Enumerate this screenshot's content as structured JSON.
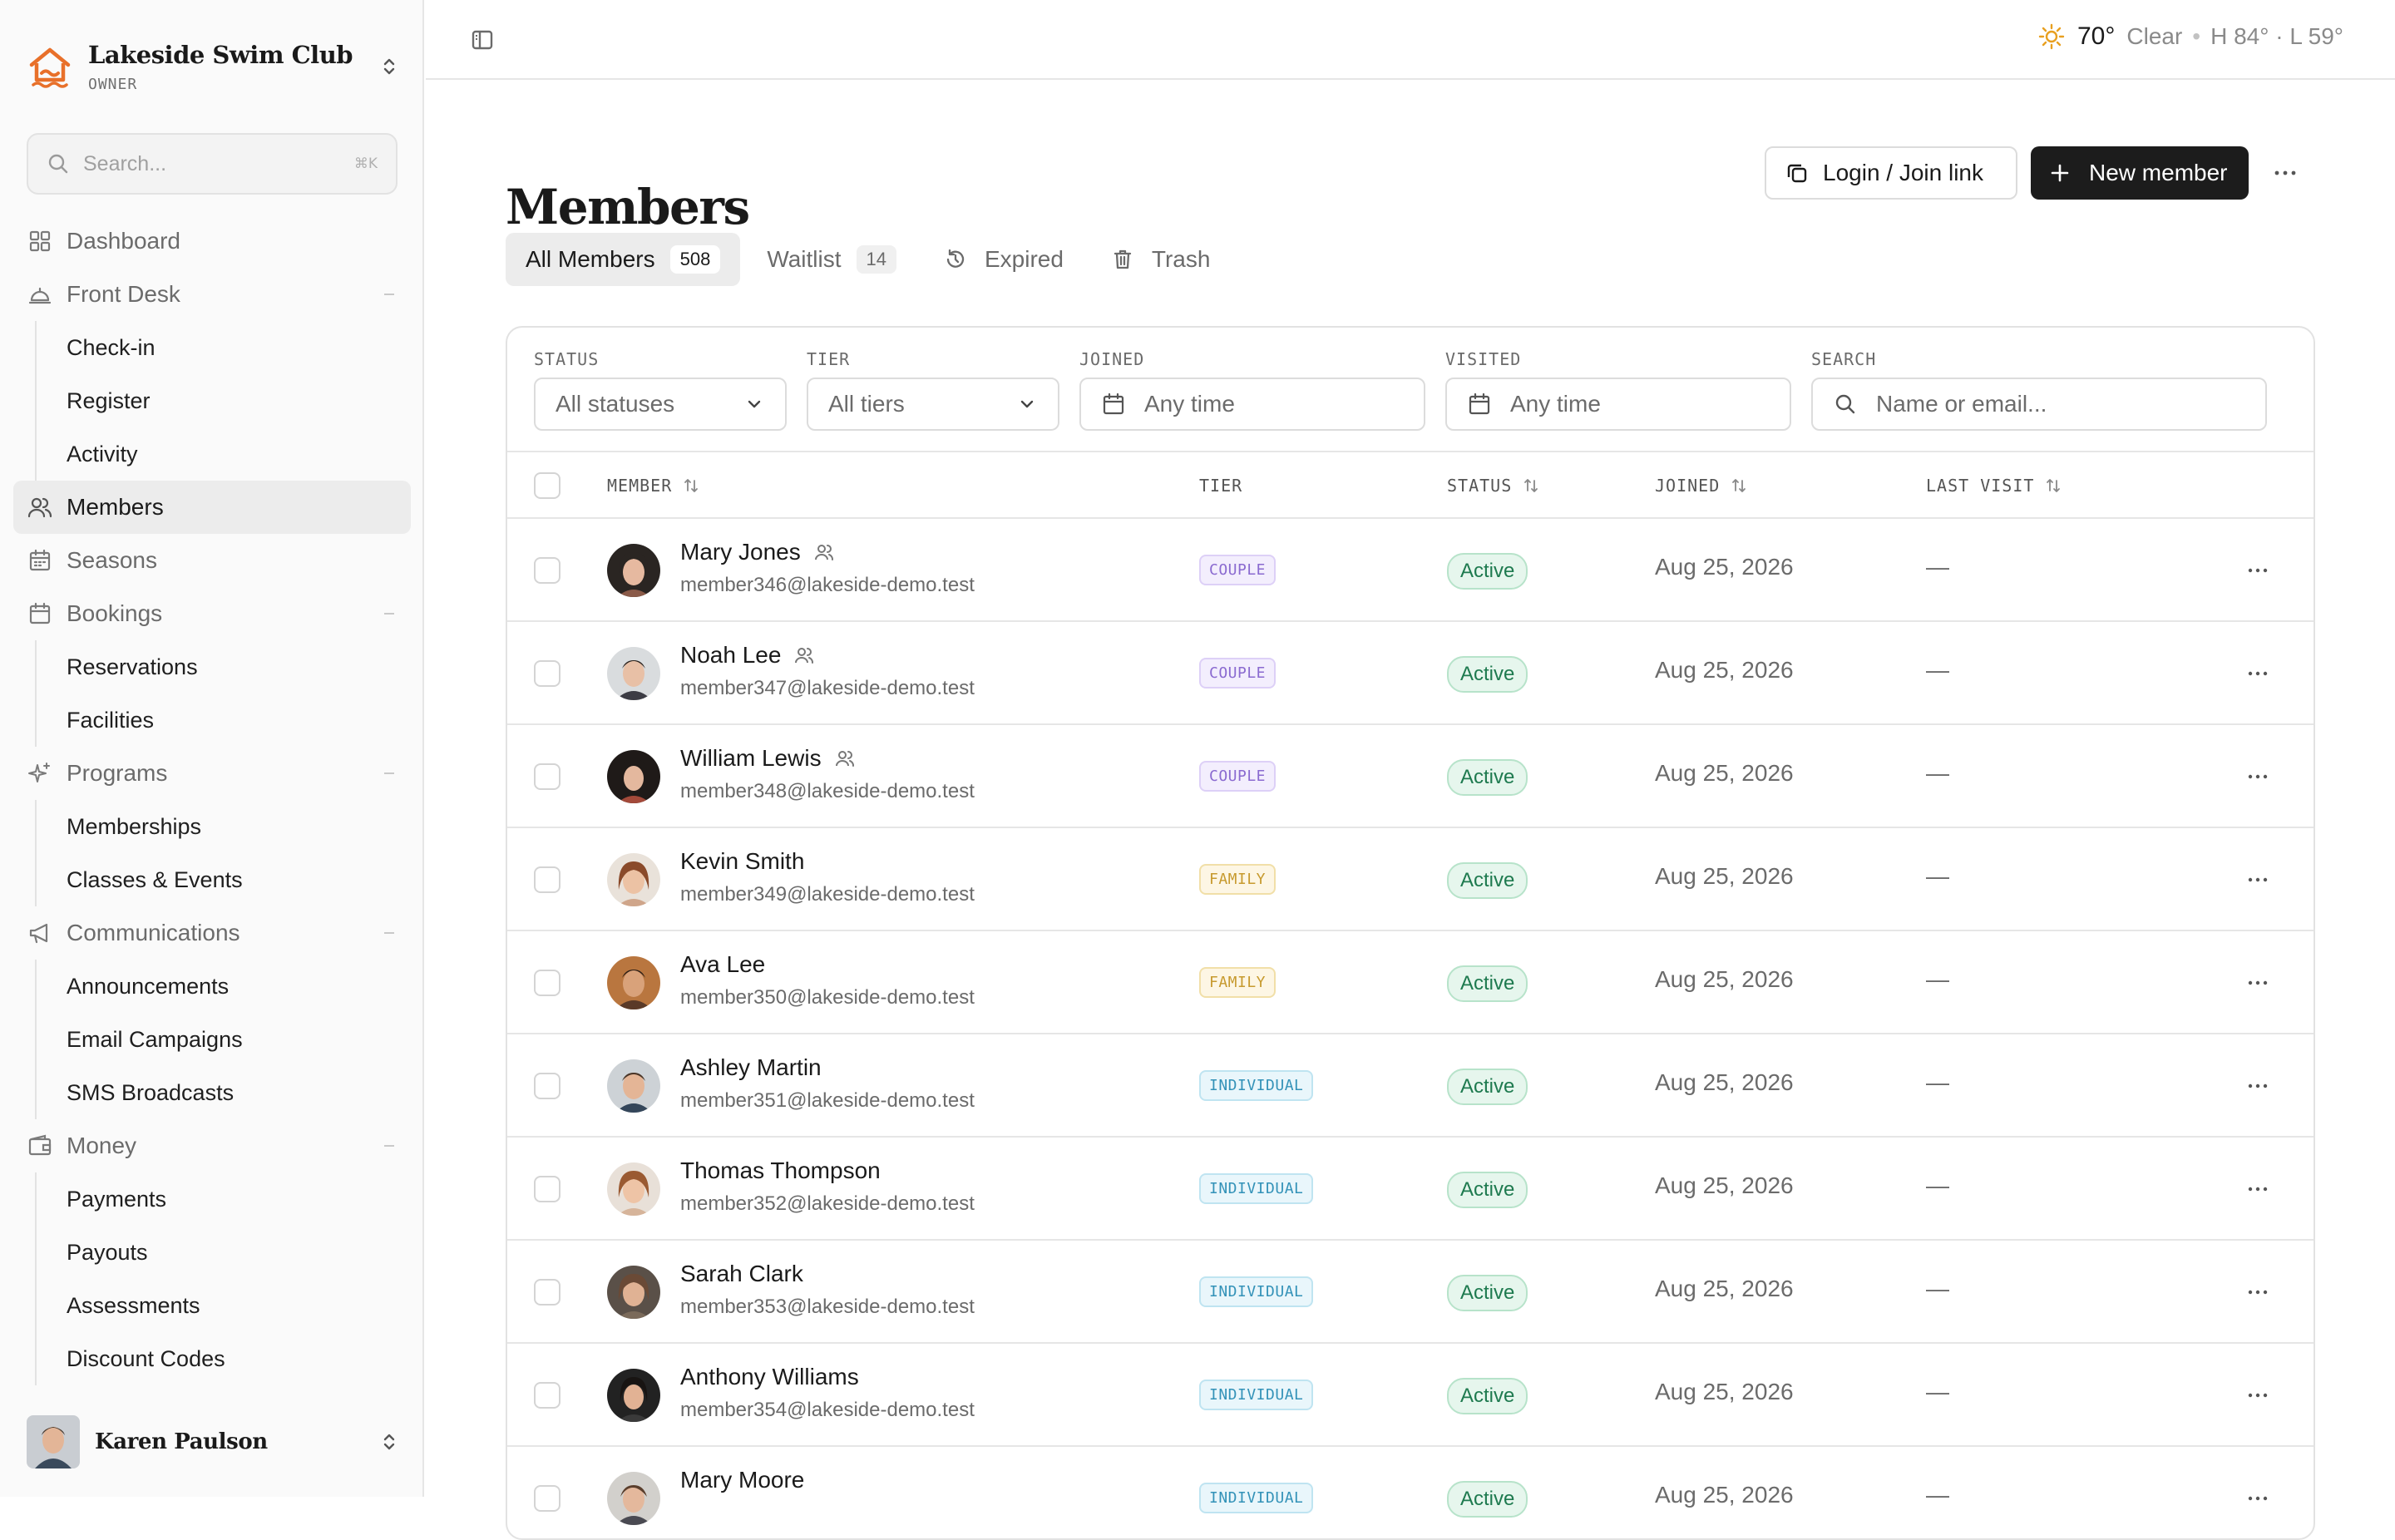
{
  "sidebar": {
    "club_name": "Lakeside Swim Club",
    "club_role": "OWNER",
    "search": {
      "placeholder": "Search...",
      "shortcut": "⌘K"
    },
    "nav": {
      "dashboard": "Dashboard",
      "front_desk": "Front Desk",
      "check_in": "Check-in",
      "register": "Register",
      "activity": "Activity",
      "members": "Members",
      "seasons": "Seasons",
      "bookings": "Bookings",
      "reservations": "Reservations",
      "facilities": "Facilities",
      "programs": "Programs",
      "memberships": "Memberships",
      "classes_events": "Classes & Events",
      "communications": "Communications",
      "announcements": "Announcements",
      "email_campaigns": "Email Campaigns",
      "sms_broadcasts": "SMS Broadcasts",
      "money": "Money",
      "payments": "Payments",
      "payouts": "Payouts",
      "assessments": "Assessments",
      "discount_codes": "Discount Codes"
    },
    "user": {
      "name": "Karen Paulson"
    }
  },
  "weather": {
    "temp": "70°",
    "condition": "Clear",
    "sep": "•",
    "high_low": "H 84° · L 59°"
  },
  "page": {
    "title": "Members",
    "login_link_label": "Login / Join link",
    "new_member_label": "New member"
  },
  "tabs": {
    "all_members": {
      "label": "All Members",
      "count": "508"
    },
    "waitlist": {
      "label": "Waitlist",
      "count": "14"
    },
    "expired": {
      "label": "Expired"
    },
    "trash": {
      "label": "Trash"
    }
  },
  "filters": {
    "status": {
      "label": "STATUS",
      "value": "All statuses"
    },
    "tier": {
      "label": "TIER",
      "value": "All tiers"
    },
    "joined": {
      "label": "JOINED",
      "value": "Any time"
    },
    "visited": {
      "label": "VISITED",
      "value": "Any time"
    },
    "search": {
      "label": "SEARCH",
      "placeholder": "Name or email..."
    }
  },
  "table": {
    "headers": {
      "member": "MEMBER",
      "tier": "TIER",
      "status": "STATUS",
      "joined": "JOINED",
      "last_visit": "LAST VISIT"
    },
    "rows": [
      {
        "name": "Mary Jones",
        "email": "member346@lakeside-demo.test",
        "tier": "COUPLE",
        "status": "Active",
        "joined": "Aug 25, 2026",
        "last_visit": "—"
      },
      {
        "name": "Noah Lee",
        "email": "member347@lakeside-demo.test",
        "tier": "COUPLE",
        "status": "Active",
        "joined": "Aug 25, 2026",
        "last_visit": "—"
      },
      {
        "name": "William Lewis",
        "email": "member348@lakeside-demo.test",
        "tier": "COUPLE",
        "status": "Active",
        "joined": "Aug 25, 2026",
        "last_visit": "—"
      },
      {
        "name": "Kevin Smith",
        "email": "member349@lakeside-demo.test",
        "tier": "FAMILY",
        "status": "Active",
        "joined": "Aug 25, 2026",
        "last_visit": "—"
      },
      {
        "name": "Ava Lee",
        "email": "member350@lakeside-demo.test",
        "tier": "FAMILY",
        "status": "Active",
        "joined": "Aug 25, 2026",
        "last_visit": "—"
      },
      {
        "name": "Ashley Martin",
        "email": "member351@lakeside-demo.test",
        "tier": "INDIVIDUAL",
        "status": "Active",
        "joined": "Aug 25, 2026",
        "last_visit": "—"
      },
      {
        "name": "Thomas Thompson",
        "email": "member352@lakeside-demo.test",
        "tier": "INDIVIDUAL",
        "status": "Active",
        "joined": "Aug 25, 2026",
        "last_visit": "—"
      },
      {
        "name": "Sarah Clark",
        "email": "member353@lakeside-demo.test",
        "tier": "INDIVIDUAL",
        "status": "Active",
        "joined": "Aug 25, 2026",
        "last_visit": "—"
      },
      {
        "name": "Anthony Williams",
        "email": "member354@lakeside-demo.test",
        "tier": "INDIVIDUAL",
        "status": "Active",
        "joined": "Aug 25, 2026",
        "last_visit": "—"
      },
      {
        "name": "Mary Moore",
        "email": "",
        "tier": "INDIVIDUAL",
        "status": "Active",
        "joined": "Aug 25, 2026",
        "last_visit": "—"
      }
    ]
  },
  "colors": {
    "accent_dark": "#1c1c1c",
    "logo_orange": "#e8702a",
    "couple": "#8a6ad0",
    "family": "#c79a2e",
    "individual": "#3392b8",
    "active": "#1e7a4f"
  },
  "icons": {
    "logo": "house-wave-logo",
    "search": "search-icon",
    "calendar": "calendar-icon",
    "chevron": "chevron-down-icon",
    "more": "more-horizontal-icon",
    "group": "group-icon"
  }
}
